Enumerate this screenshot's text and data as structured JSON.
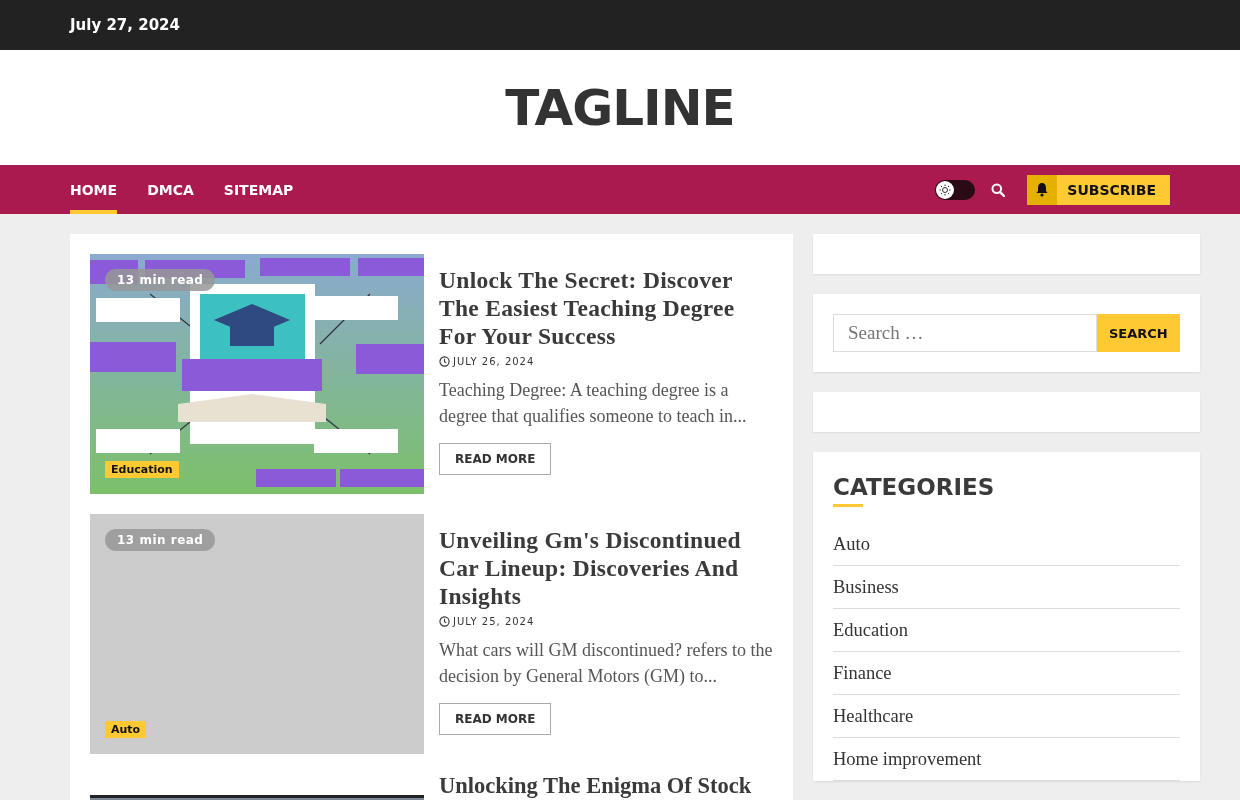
{
  "top_bar": {
    "date": "July 27, 2024"
  },
  "header": {
    "site_title": "TAGLINE"
  },
  "nav": {
    "items": [
      {
        "label": "HOME",
        "selected": true
      },
      {
        "label": "DMCA",
        "selected": false
      },
      {
        "label": "SITEMAP",
        "selected": false
      }
    ],
    "dark_mode": false,
    "subscribe": "SUBSCRIBE"
  },
  "posts": [
    {
      "kind": "picture",
      "read_time": "13 min read",
      "category": "Education",
      "title": "Unlock The Secret: Discover The Easiest Teaching Degree For Your Success",
      "date": "JULY 26, 2024",
      "excerpt": "Teaching Degree: A teaching degree is a degree that qualifies someone to teach in...",
      "button": "READ MORE"
    },
    {
      "kind": "placeholder",
      "read_time": "13 min read",
      "category": "Auto",
      "title": "Unveiling Gm's Discontinued Car Lineup: Discoveries And Insights",
      "date": "JULY 25, 2024",
      "excerpt": "What cars will GM discontinued? refers to the decision by General Motors (GM) to...",
      "button": "READ MORE"
    },
    {
      "kind": "picture",
      "title": "Unlocking The Enigma Of Stock"
    }
  ],
  "sidebar": {
    "search": {
      "placeholder": "Search …",
      "button": "SEARCH"
    },
    "categories": {
      "title": "CATEGORIES",
      "items": [
        "Auto",
        "Business",
        "Education",
        "Finance",
        "Healthcare",
        "Home improvement"
      ]
    }
  }
}
